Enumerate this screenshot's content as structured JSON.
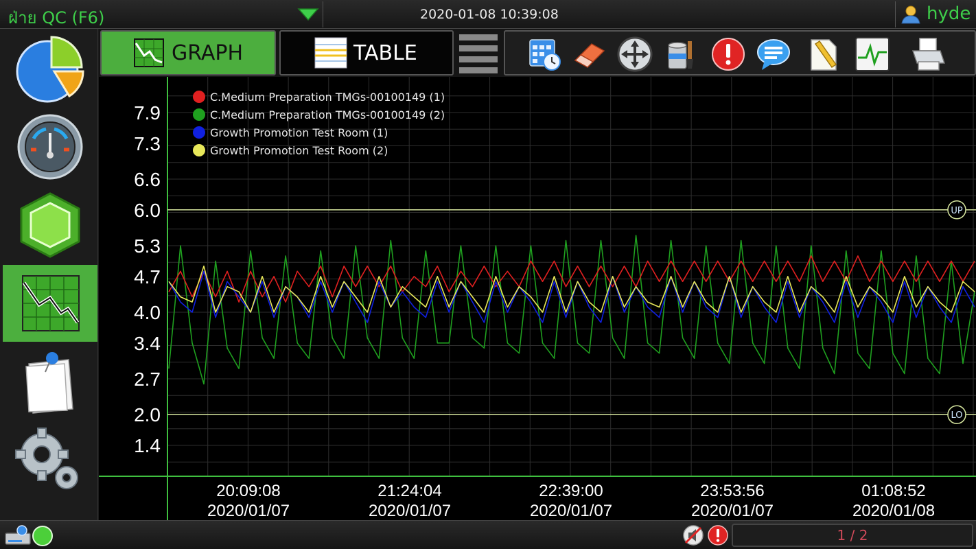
{
  "header": {
    "title": "ฝ่าย QC (F6)",
    "datetime": "2020-01-08  10:39:08",
    "user": "hyde"
  },
  "sidebar": {
    "items": [
      {
        "name": "pie-chart-icon"
      },
      {
        "name": "gauge-icon"
      },
      {
        "name": "hexagon-icon"
      },
      {
        "name": "graph-icon",
        "active": true
      },
      {
        "name": "note-icon"
      },
      {
        "name": "settings-gears-icon"
      }
    ]
  },
  "tabs": {
    "graph_label": "GRAPH",
    "table_label": "TABLE",
    "active": "GRAPH"
  },
  "toolbar": {
    "icons": [
      "calendar-clock-icon",
      "eraser-icon",
      "move-arrows-icon",
      "paint-bucket-icon",
      "alert-icon",
      "message-bubble-icon",
      "note-pencil-icon",
      "trend-line-icon",
      "printer-icon"
    ]
  },
  "footer": {
    "page": "1 / 2"
  },
  "colors": {
    "accent": "#4caf3e",
    "series_red": "#e02020",
    "series_green": "#1fa01f",
    "series_blue": "#1020e0",
    "series_yellow": "#e8e85a",
    "limit_line": "#d8e8a0"
  },
  "chart_data": {
    "type": "line",
    "title": "",
    "xlabel": "",
    "ylabel": "",
    "ylim": [
      1.0,
      8.3
    ],
    "yticks": [
      "7.9",
      "7.3",
      "6.6",
      "6.0",
      "5.3",
      "4.7",
      "4.0",
      "3.4",
      "2.7",
      "2.0",
      "1.4"
    ],
    "ytick_values": [
      7.9,
      7.3,
      6.6,
      6.0,
      5.3,
      4.7,
      4.0,
      3.4,
      2.7,
      2.0,
      1.4
    ],
    "xticks": [
      {
        "time": "20:09:08",
        "date": "2020/01/07"
      },
      {
        "time": "21:24:04",
        "date": "2020/01/07"
      },
      {
        "time": "22:39:00",
        "date": "2020/01/07"
      },
      {
        "time": "23:53:56",
        "date": "2020/01/07"
      },
      {
        "time": "01:08:52",
        "date": "2020/01/08"
      }
    ],
    "x_range": [
      "19:41",
      "01:40"
    ],
    "limits": [
      {
        "label": "UP",
        "value": 6.0
      },
      {
        "label": "LO",
        "value": 2.0
      }
    ],
    "grid": true,
    "legend_position": "top-left",
    "series": [
      {
        "name": "C.Medium Preparation TMGs-00100149 (1)",
        "color": "#e02020",
        "values": [
          4.4,
          4.8,
          4.3,
          4.8,
          4.3,
          4.8,
          4.2,
          4.8,
          4.3,
          4.7,
          4.2,
          4.8,
          4.5,
          4.9,
          4.3,
          4.9,
          4.5,
          4.9,
          4.5,
          4.9,
          4.4,
          4.7,
          4.5,
          4.9,
          4.4,
          4.8,
          4.5,
          4.9,
          4.5,
          4.8,
          4.5,
          5.0,
          4.6,
          5.0,
          4.5,
          4.9,
          4.5,
          4.9,
          4.5,
          4.9,
          4.5,
          5.0,
          4.6,
          5.0,
          4.6,
          5.0,
          4.6,
          5.0,
          4.6,
          5.0,
          4.6,
          5.0,
          4.6,
          5.0,
          4.6,
          5.1,
          4.6,
          5.0,
          4.6,
          5.1,
          4.6,
          5.0,
          4.6,
          5.0,
          4.6,
          5.0,
          4.6,
          5.0,
          4.6,
          5.0
        ]
      },
      {
        "name": "C.Medium Preparation TMGs-00100149 (2)",
        "color": "#1fa01f",
        "values": [
          2.9,
          5.3,
          3.4,
          2.6,
          5.0,
          3.3,
          2.9,
          5.2,
          3.5,
          3.1,
          5.1,
          3.4,
          3.1,
          5.2,
          3.5,
          3.1,
          5.3,
          3.5,
          3.1,
          5.4,
          3.5,
          3.1,
          5.2,
          3.4,
          3.4,
          5.3,
          3.5,
          3.3,
          5.3,
          3.4,
          3.2,
          5.3,
          3.4,
          3.1,
          5.4,
          3.4,
          3.2,
          5.4,
          3.5,
          3.1,
          5.5,
          3.4,
          3.2,
          5.4,
          3.5,
          3.1,
          5.3,
          3.4,
          3.0,
          5.4,
          3.4,
          3.0,
          5.3,
          3.3,
          2.9,
          5.3,
          3.3,
          2.8,
          5.2,
          3.2,
          2.9,
          5.2,
          3.2,
          2.8,
          5.1,
          3.1,
          2.8,
          5.0,
          3.0,
          4.4
        ]
      },
      {
        "name": "Growth Promotion Test Room (1)",
        "color": "#1020e0",
        "values": [
          4.6,
          4.2,
          4.0,
          4.8,
          3.9,
          4.6,
          4.3,
          4.0,
          4.6,
          3.9,
          4.5,
          4.3,
          3.9,
          4.6,
          4.0,
          4.6,
          4.2,
          3.8,
          4.6,
          4.1,
          4.4,
          4.1,
          3.9,
          4.6,
          4.0,
          4.6,
          4.2,
          3.8,
          4.6,
          4.0,
          4.5,
          4.2,
          3.8,
          4.6,
          3.9,
          4.6,
          4.1,
          3.8,
          4.7,
          4.0,
          4.5,
          4.1,
          3.9,
          4.7,
          4.0,
          4.6,
          4.1,
          3.9,
          4.7,
          3.9,
          4.5,
          4.1,
          3.8,
          4.6,
          3.9,
          4.5,
          4.2,
          3.8,
          4.6,
          3.9,
          4.5,
          4.2,
          3.8,
          4.6,
          3.9,
          4.5,
          4.1,
          3.8,
          4.5,
          4.1
        ]
      },
      {
        "name": "Growth Promotion Test Room (2)",
        "color": "#e8e85a",
        "values": [
          4.6,
          4.3,
          4.2,
          4.9,
          4.0,
          4.5,
          4.4,
          4.0,
          4.7,
          4.0,
          4.5,
          4.3,
          4.0,
          4.7,
          4.1,
          4.6,
          4.3,
          4.0,
          4.7,
          4.1,
          4.5,
          4.3,
          4.1,
          4.7,
          4.1,
          4.6,
          4.3,
          4.0,
          4.7,
          4.1,
          4.5,
          4.3,
          4.0,
          4.7,
          4.0,
          4.6,
          4.2,
          4.0,
          4.7,
          4.1,
          4.5,
          4.2,
          4.1,
          4.7,
          4.1,
          4.6,
          4.2,
          4.0,
          4.7,
          4.0,
          4.5,
          4.2,
          4.0,
          4.7,
          4.0,
          4.5,
          4.3,
          4.0,
          4.7,
          4.1,
          4.5,
          4.3,
          4.0,
          4.7,
          4.1,
          4.5,
          4.2,
          4.0,
          4.6,
          4.4
        ]
      }
    ]
  }
}
